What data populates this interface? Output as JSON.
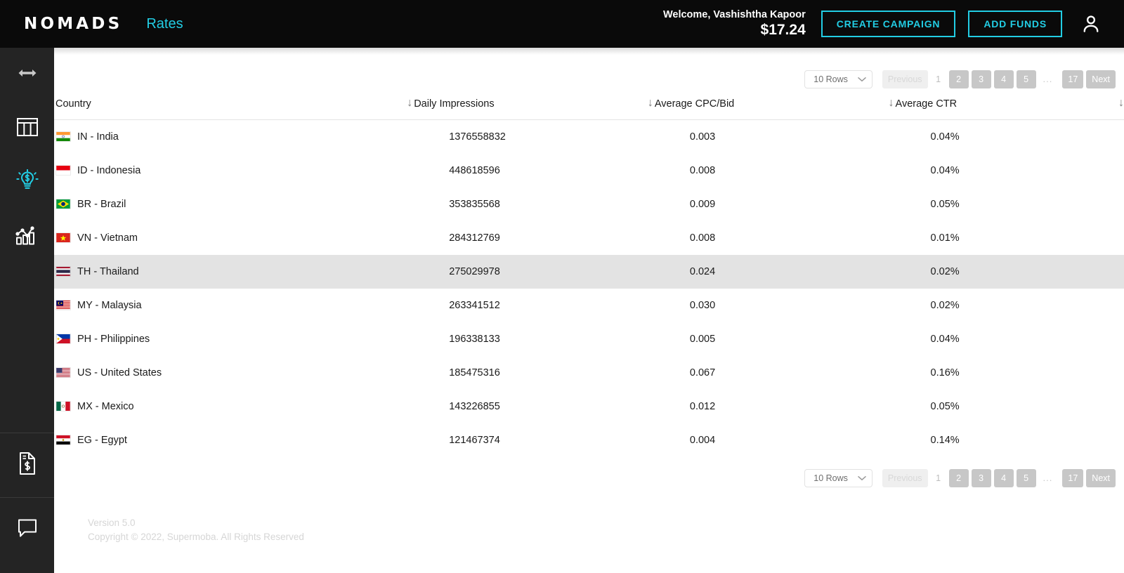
{
  "header": {
    "brand": "NOMADS",
    "page_title": "Rates",
    "welcome_text": "Welcome, Vashishtha Kapoor",
    "balance": "$17.24",
    "create_campaign_label": "CREATE CAMPAIGN",
    "add_funds_label": "ADD FUNDS",
    "accent_color": "#22cde4",
    "bar_color": "#0a0a0a"
  },
  "sidebar": {
    "background": "#242424",
    "items": [
      {
        "icon": "expand-horizontal-icon",
        "active": false
      },
      {
        "icon": "table-grid-icon",
        "active": false
      },
      {
        "icon": "lightbulb-dollar-icon",
        "active": true
      },
      {
        "icon": "bar-chart-icon",
        "active": false
      },
      {
        "icon": "invoice-dollar-icon",
        "active": false
      },
      {
        "icon": "chat-bubble-icon",
        "active": false
      }
    ],
    "active_color": "#22cde4",
    "inactive_color": "#ffffff"
  },
  "pagination": {
    "rows_select_value": "10 Rows",
    "previous_label": "Previous",
    "next_label": "Next",
    "current_page": "1",
    "pages": [
      "2",
      "3",
      "4",
      "5"
    ],
    "ellipsis": "...",
    "last_page": "17"
  },
  "table": {
    "columns": [
      {
        "label": "Country",
        "sort_icon": "sort-descending-arrow-icon"
      },
      {
        "label": "Daily Impressions",
        "sort_icon": "sort-descending-arrow-icon"
      },
      {
        "label": "Average CPC/Bid",
        "sort_icon": "sort-descending-arrow-icon"
      },
      {
        "label": "Average CTR",
        "sort_icon": "sort-descending-arrow-icon"
      }
    ],
    "highlighted_row_index": 4,
    "highlight_color": "#e3e3e3",
    "rows": [
      {
        "flag": "flag-in",
        "country": "IN - India",
        "impressions": "1376558832",
        "cpc": "0.003",
        "ctr": "0.04%"
      },
      {
        "flag": "flag-id",
        "country": "ID - Indonesia",
        "impressions": "448618596",
        "cpc": "0.008",
        "ctr": "0.04%"
      },
      {
        "flag": "flag-br",
        "country": "BR - Brazil",
        "impressions": "353835568",
        "cpc": "0.009",
        "ctr": "0.05%"
      },
      {
        "flag": "flag-vn",
        "country": "VN - Vietnam",
        "impressions": "284312769",
        "cpc": "0.008",
        "ctr": "0.01%"
      },
      {
        "flag": "flag-th",
        "country": "TH - Thailand",
        "impressions": "275029978",
        "cpc": "0.024",
        "ctr": "0.02%"
      },
      {
        "flag": "flag-my",
        "country": "MY - Malaysia",
        "impressions": "263341512",
        "cpc": "0.030",
        "ctr": "0.02%"
      },
      {
        "flag": "flag-ph",
        "country": "PH - Philippines",
        "impressions": "196338133",
        "cpc": "0.005",
        "ctr": "0.04%"
      },
      {
        "flag": "flag-us",
        "country": "US - United States",
        "impressions": "185475316",
        "cpc": "0.067",
        "ctr": "0.16%"
      },
      {
        "flag": "flag-mx",
        "country": "MX - Mexico",
        "impressions": "143226855",
        "cpc": "0.012",
        "ctr": "0.05%"
      },
      {
        "flag": "flag-eg",
        "country": "EG - Egypt",
        "impressions": "121467374",
        "cpc": "0.004",
        "ctr": "0.14%"
      }
    ]
  },
  "footer": {
    "version": "Version 5.0",
    "copyright": "Copyright © 2022, Supermoba. All Rights Reserved"
  }
}
